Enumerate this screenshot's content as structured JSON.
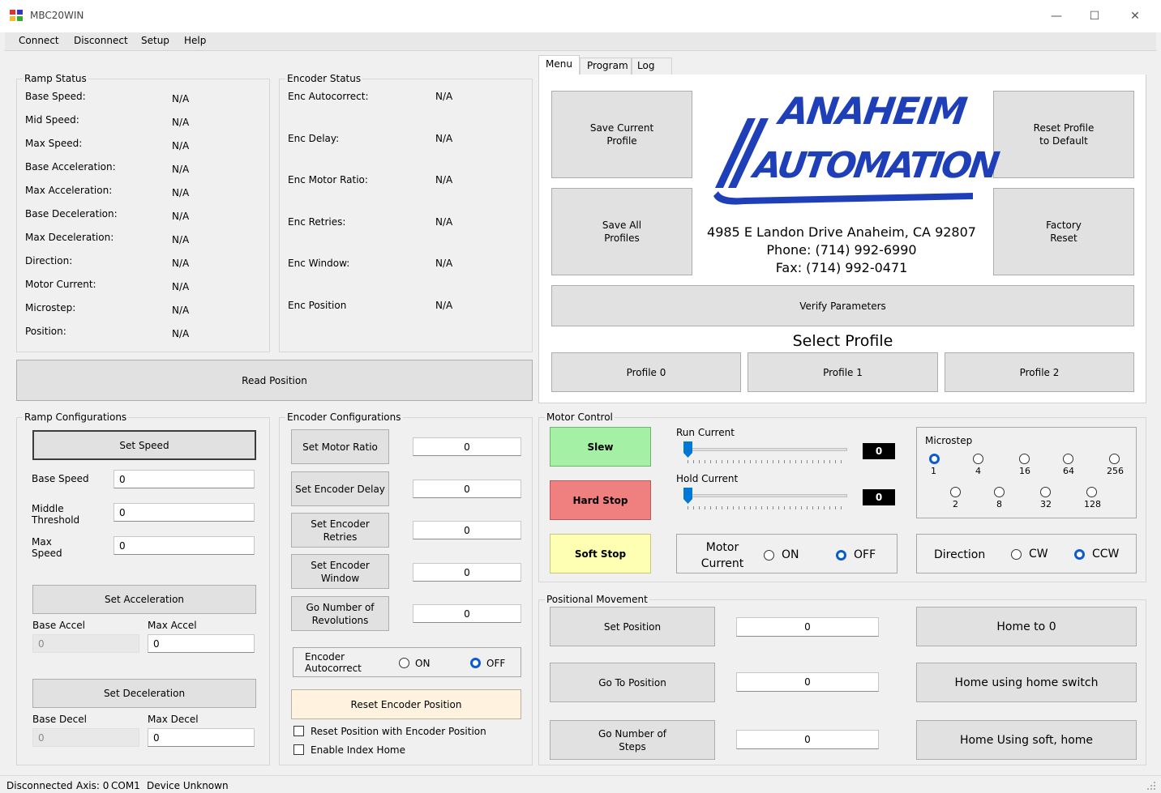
{
  "window": {
    "title": "MBC20WIN",
    "minimize": "—",
    "maximize": "☐",
    "close": "✕"
  },
  "menu": {
    "connect": "Connect",
    "disconnect": "Disconnect",
    "setup": "Setup",
    "help": "Help"
  },
  "ramp_status": {
    "title": "Ramp Status",
    "rows": [
      {
        "label": "Base Speed:",
        "value": "N/A"
      },
      {
        "label": "Mid Speed:",
        "value": "N/A"
      },
      {
        "label": "Max Speed:",
        "value": "N/A"
      },
      {
        "label": "Base Acceleration:",
        "value": "N/A"
      },
      {
        "label": "Max Acceleration:",
        "value": "N/A"
      },
      {
        "label": "Base Deceleration:",
        "value": "N/A"
      },
      {
        "label": "Max Deceleration:",
        "value": "N/A"
      },
      {
        "label": "Direction:",
        "value": "N/A"
      },
      {
        "label": "Motor Current:",
        "value": "N/A"
      },
      {
        "label": "Microstep:",
        "value": "N/A"
      },
      {
        "label": "Position:",
        "value": "N/A"
      }
    ]
  },
  "encoder_status": {
    "title": "Encoder Status",
    "rows": [
      {
        "label": "Enc Autocorrect:",
        "value": "N/A"
      },
      {
        "label": "Enc Delay:",
        "value": "N/A"
      },
      {
        "label": "Enc Motor Ratio:",
        "value": "N/A"
      },
      {
        "label": "Enc Retries:",
        "value": "N/A"
      },
      {
        "label": "Enc Window:",
        "value": "N/A"
      },
      {
        "label": "Enc Position",
        "value": "N/A"
      }
    ]
  },
  "read_position": "Read Position",
  "tabs": [
    {
      "label": "Menu"
    },
    {
      "label": "Program"
    },
    {
      "label": "Log"
    }
  ],
  "menu_tab": {
    "save_current_profile": "Save Current Profile",
    "save_all_profiles": "Save All Profiles",
    "reset_profile": "Reset Profile to Default",
    "factory_reset": "Factory Reset",
    "logo_line1": "ANAHEIM",
    "logo_line2": "AUTOMATION",
    "address": "4985 E Landon Drive Anaheim, CA 92807",
    "phone": "Phone: (714) 992-6990",
    "fax": "Fax: (714) 992-0471",
    "verify": "Verify Parameters",
    "select_profile": "Select Profile",
    "profiles": [
      "Profile 0",
      "Profile 1",
      "Profile 2"
    ]
  },
  "ramp_config": {
    "title": "Ramp Configurations",
    "set_speed": "Set Speed",
    "base_speed_label": "Base Speed",
    "base_speed_value": "0",
    "middle_threshold_label": "Middle Threshold",
    "middle_threshold_value": "0",
    "max_speed_label": "Max Speed",
    "max_speed_value": "0",
    "set_accel": "Set Acceleration",
    "base_accel_label": "Base Accel",
    "base_accel_value": "0",
    "max_accel_label": "Max Accel",
    "max_accel_value": "0",
    "set_decel": "Set Deceleration",
    "base_decel_label": "Base Decel",
    "base_decel_value": "0",
    "max_decel_label": "Max Decel",
    "max_decel_value": "0"
  },
  "encoder_config": {
    "title": "Encoder Configurations",
    "set_motor_ratio": "Set Motor Ratio",
    "motor_ratio_value": "0",
    "set_encoder_delay": "Set Encoder Delay",
    "encoder_delay_value": "0",
    "set_encoder_retries": "Set Encoder Retries",
    "encoder_retries_value": "0",
    "set_encoder_window": "Set Encoder Window",
    "encoder_window_value": "0",
    "go_revolutions": "Go Number of Revolutions",
    "revolutions_value": "0",
    "autocorrect_label": "Encoder Autocorrect",
    "on": "ON",
    "off": "OFF",
    "reset_encoder_position": "Reset Encoder Position",
    "reset_with_encoder": "Reset Position with Encoder Position",
    "enable_index_home": "Enable Index Home"
  },
  "motor_control": {
    "title": "Motor Control",
    "slew": "Slew",
    "hard_stop": "Hard Stop",
    "soft_stop": "Soft Stop",
    "run_current_label": "Run Current",
    "run_current_value": "0",
    "hold_current_label": "Hold Current",
    "hold_current_value": "0",
    "microstep_title": "Microstep",
    "microstep_row1": [
      "1",
      "4",
      "16",
      "64",
      "256"
    ],
    "microstep_row2": [
      "2",
      "8",
      "32",
      "128"
    ],
    "microstep_selected": "1",
    "motor_current_label": "Motor Current",
    "on": "ON",
    "off": "OFF",
    "direction_label": "Direction",
    "cw": "CW",
    "ccw": "CCW"
  },
  "positional": {
    "title": "Positional Movement",
    "set_position": "Set Position",
    "set_position_value": "0",
    "go_to_position": "Go To Position",
    "go_to_position_value": "0",
    "go_steps": "Go Number of Steps",
    "go_steps_value": "0",
    "home_to_0": "Home to 0",
    "home_switch": "Home using home switch",
    "home_soft": "Home Using soft, home"
  },
  "status": {
    "connection": "Disconnected",
    "axis": "Axis: 0",
    "port": "COM1",
    "device": "Device Unknown"
  },
  "colors": {
    "slew": "#a4f0a4",
    "hard_stop": "#f08080",
    "soft_stop": "#ffffb4",
    "reset_encoder": "#fff3e0",
    "logo_blue": "#1f3fb8",
    "radio_blue": "#0a5bd3"
  }
}
